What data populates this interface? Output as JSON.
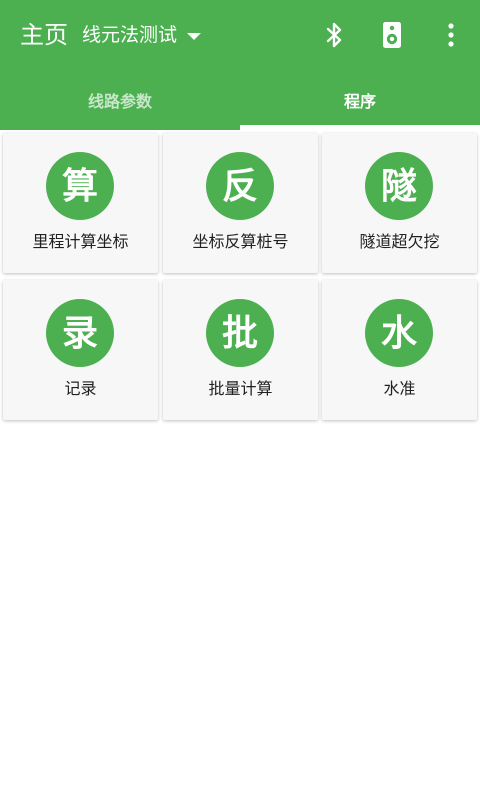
{
  "header": {
    "title": "主页",
    "project_name": "线元法测试",
    "icons": [
      "bluetooth-icon",
      "speaker-icon",
      "more-vertical-icon"
    ]
  },
  "tabs": [
    {
      "label": "线路参数",
      "selected": false
    },
    {
      "label": "程序",
      "selected": true
    }
  ],
  "tools": [
    {
      "glyph": "算",
      "label": "里程计算坐标"
    },
    {
      "glyph": "反",
      "label": "坐标反算桩号"
    },
    {
      "glyph": "隧",
      "label": "隧道超欠挖"
    },
    {
      "glyph": "录",
      "label": "记录"
    },
    {
      "glyph": "批",
      "label": "批量计算"
    },
    {
      "glyph": "水",
      "label": "水准"
    }
  ],
  "colors": {
    "primary": "#4caf50",
    "tab_inactive": "#c8e6c9",
    "card_bg": "#f7f7f8",
    "text": "#212121"
  }
}
